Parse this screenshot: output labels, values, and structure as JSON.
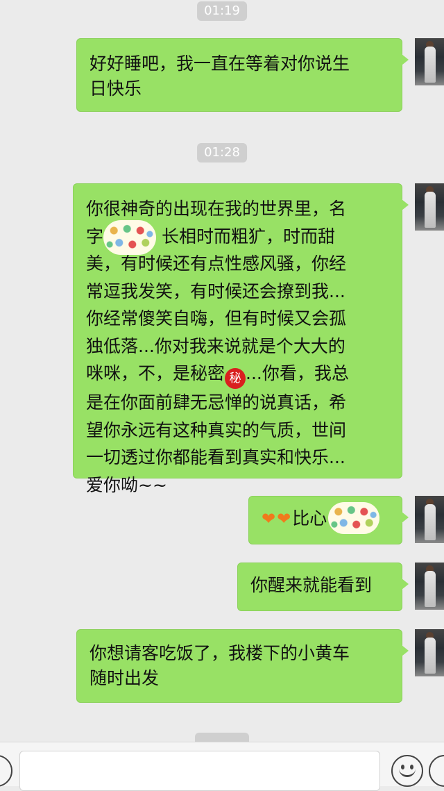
{
  "timestamps": [
    "01:19",
    "01:28"
  ],
  "messages": [
    {
      "line1": "好好睡吧，我一直在等着对你说生",
      "line2": "日快乐"
    },
    {
      "p1a": "你很神奇的出现在我的世界里，名",
      "p1b": "字",
      "p1c": " 长相时而粗犷，时而甜",
      "p2": "美，有时候还有点性感风骚，你经",
      "p3": "常逗我发笑，有时候还会撩到我...",
      "p4": "你经常傻笑自嗨，但有时候又会孤",
      "p5": "独低落...你对我来说就是个大大的",
      "p6a": "咪咪，不，是秘密",
      "secret_emoji": "秘",
      "p6b": "...你看，我总",
      "p7": "是在你面前肆无忌惮的说真话，希",
      "p8": "望你永远有这种真实的气质，世间",
      "p9": "一切透过你都能看到真实和快乐...",
      "p10": "爱你呦~~"
    },
    {
      "hearts": "❤❤",
      "text": "比心"
    },
    {
      "text": "你醒来就能看到"
    },
    {
      "line1": "你想请客吃饭了，我楼下的小黄车",
      "line2": "随时出发"
    }
  ],
  "colors": {
    "bubble": "#98e165",
    "background": "#ebebeb",
    "timestamp_bg": "#cfcfcf"
  },
  "icons": [
    "avatar",
    "blurred-name-sticker",
    "secret-emoji",
    "heart-emoji",
    "emoji-icon",
    "plus-icon",
    "voice-icon"
  ]
}
